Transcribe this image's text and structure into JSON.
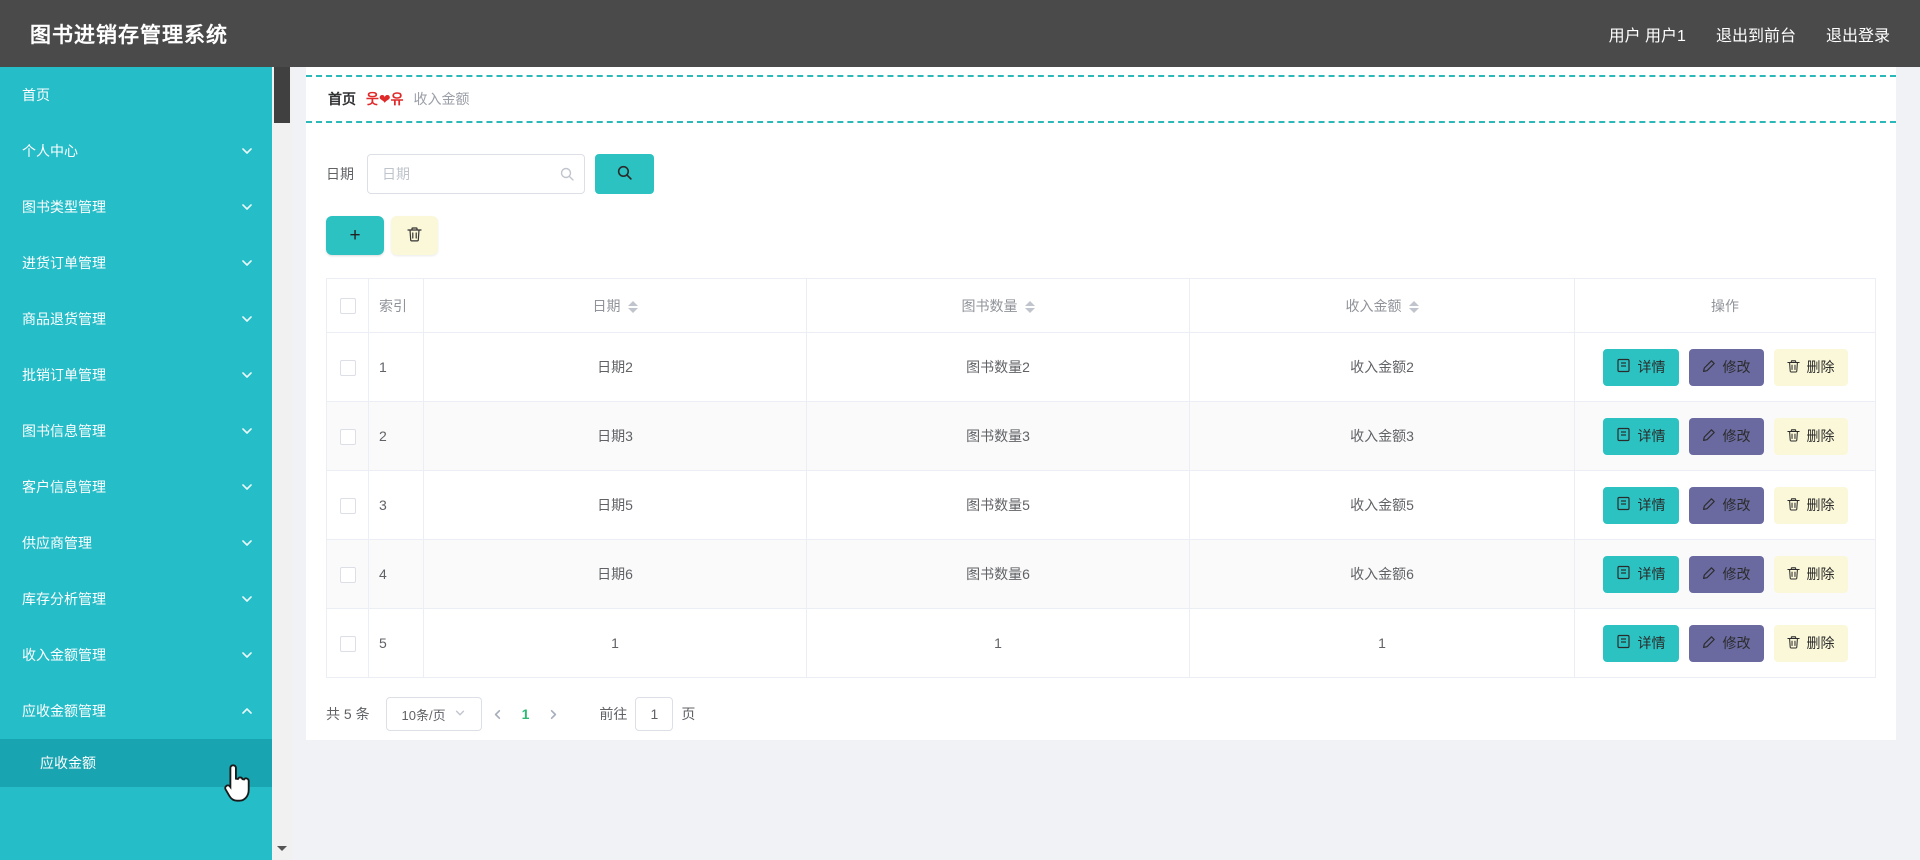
{
  "header": {
    "title": "图书进销存管理系统",
    "user": "用户 用户1",
    "logout_front": "退出到前台",
    "logout": "退出登录"
  },
  "sidebar": {
    "items": [
      {
        "label": "首页"
      },
      {
        "label": "个人中心"
      },
      {
        "label": "图书类型管理"
      },
      {
        "label": "进货订单管理"
      },
      {
        "label": "商品退货管理"
      },
      {
        "label": "批销订单管理"
      },
      {
        "label": "图书信息管理"
      },
      {
        "label": "客户信息管理"
      },
      {
        "label": "供应商管理"
      },
      {
        "label": "库存分析管理"
      },
      {
        "label": "收入金额管理"
      },
      {
        "label": "应收金额管理",
        "expanded": true,
        "children": [
          {
            "label": "应收金额",
            "active": true
          }
        ]
      }
    ]
  },
  "breadcrumb": {
    "home": "首页",
    "separator": "웃❤유",
    "current": "收入金额"
  },
  "search": {
    "label": "日期",
    "placeholder": "日期"
  },
  "toolbar": {
    "add_label": "+"
  },
  "table": {
    "columns": [
      {
        "label": ""
      },
      {
        "label": "索引"
      },
      {
        "label": "日期",
        "sortable": true
      },
      {
        "label": "图书数量",
        "sortable": true
      },
      {
        "label": "收入金额",
        "sortable": true
      },
      {
        "label": "操作"
      }
    ],
    "rows": [
      {
        "index": "1",
        "date": "日期2",
        "quantity": "图书数量2",
        "amount": "收入金额2"
      },
      {
        "index": "2",
        "date": "日期3",
        "quantity": "图书数量3",
        "amount": "收入金额3"
      },
      {
        "index": "3",
        "date": "日期5",
        "quantity": "图书数量5",
        "amount": "收入金额5"
      },
      {
        "index": "4",
        "date": "日期6",
        "quantity": "图书数量6",
        "amount": "收入金额6"
      },
      {
        "index": "5",
        "date": "1",
        "quantity": "1",
        "amount": "1"
      }
    ],
    "actions": {
      "detail": "详情",
      "edit": "修改",
      "remove": "删除"
    }
  },
  "pagination": {
    "total_label": "共 5 条",
    "page_size": "10条/页",
    "current_page": "1",
    "goto_label": "前往",
    "goto_value": "1",
    "page_unit": "页"
  },
  "icons": {
    "search": "search-icon",
    "add": "plus-icon",
    "delete": "trash-icon",
    "detail": "document-icon",
    "edit": "pencil-icon",
    "expand": "chevron-down-icon",
    "collapse": "chevron-up-icon",
    "prev": "chevron-left-icon",
    "next": "chevron-right-icon",
    "cursor": "hand-cursor"
  },
  "colors": {
    "header_bg": "#4a4a4a",
    "sidebar_bg": "#24bdc8",
    "sidebar_active_bg": "#18a4b0",
    "accent_teal": "#2cc2c2",
    "edit_purple": "#6a6aa1",
    "delete_yellow": "#fbf8d9",
    "dashed_border": "#2bb8b8",
    "breadcrumb_red": "#e02929",
    "active_page_green": "#2eb872"
  }
}
